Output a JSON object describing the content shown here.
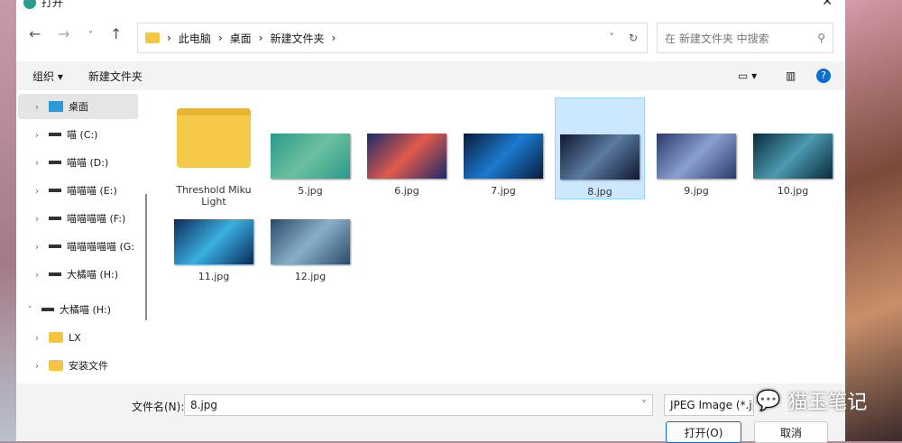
{
  "title": "打开",
  "address": {
    "crumbs": [
      "此电脑",
      "桌面",
      "新建文件夹"
    ]
  },
  "search": {
    "placeholder": "在 新建文件夹 中搜索"
  },
  "toolbar": {
    "organize": "组织 ▾",
    "new_folder": "新建文件夹"
  },
  "sidebar": {
    "items": [
      {
        "label": "桌面",
        "type": "desktop"
      },
      {
        "label": "喵 (C:)",
        "type": "drive"
      },
      {
        "label": "喵喵 (D:)",
        "type": "drive"
      },
      {
        "label": "喵喵喵 (E:)",
        "type": "drive"
      },
      {
        "label": "喵喵喵喵 (F:)",
        "type": "drive"
      },
      {
        "label": "喵喵喵喵喵 (G:",
        "type": "drive"
      },
      {
        "label": "大橘喵 (H:)",
        "type": "drive"
      },
      {
        "label": "大橘喵 (H:)",
        "type": "drive"
      },
      {
        "label": "LX",
        "type": "folder"
      },
      {
        "label": "安装文件",
        "type": "folder"
      }
    ]
  },
  "files": [
    {
      "name": "Threshold Miku Light",
      "type": "folder"
    },
    {
      "name": "5.jpg",
      "colors": [
        "#2a9a8a",
        "#6cc0a0"
      ]
    },
    {
      "name": "6.jpg",
      "colors": [
        "#1a2a6a",
        "#e05a4a"
      ]
    },
    {
      "name": "7.jpg",
      "colors": [
        "#0a1a3a",
        "#1a7ad0"
      ]
    },
    {
      "name": "8.jpg",
      "colors": [
        "#101830",
        "#5a7aa0"
      ],
      "selected": true
    },
    {
      "name": "9.jpg",
      "colors": [
        "#2a3a6a",
        "#8aa0d0"
      ]
    },
    {
      "name": "10.jpg",
      "colors": [
        "#0a2a3a",
        "#4a9ab0"
      ]
    },
    {
      "name": "11.jpg",
      "colors": [
        "#0a2a5a",
        "#3ab0e0"
      ]
    },
    {
      "name": "12.jpg",
      "colors": [
        "#2a4a6a",
        "#8ab0c8"
      ]
    }
  ],
  "bottom": {
    "filename_label": "文件名(N):",
    "filename_value": "8.jpg",
    "filetype": "JPEG Image (*.jpg",
    "open": "打开(O)",
    "cancel": "取消"
  },
  "watermark": "猫玉笔记"
}
